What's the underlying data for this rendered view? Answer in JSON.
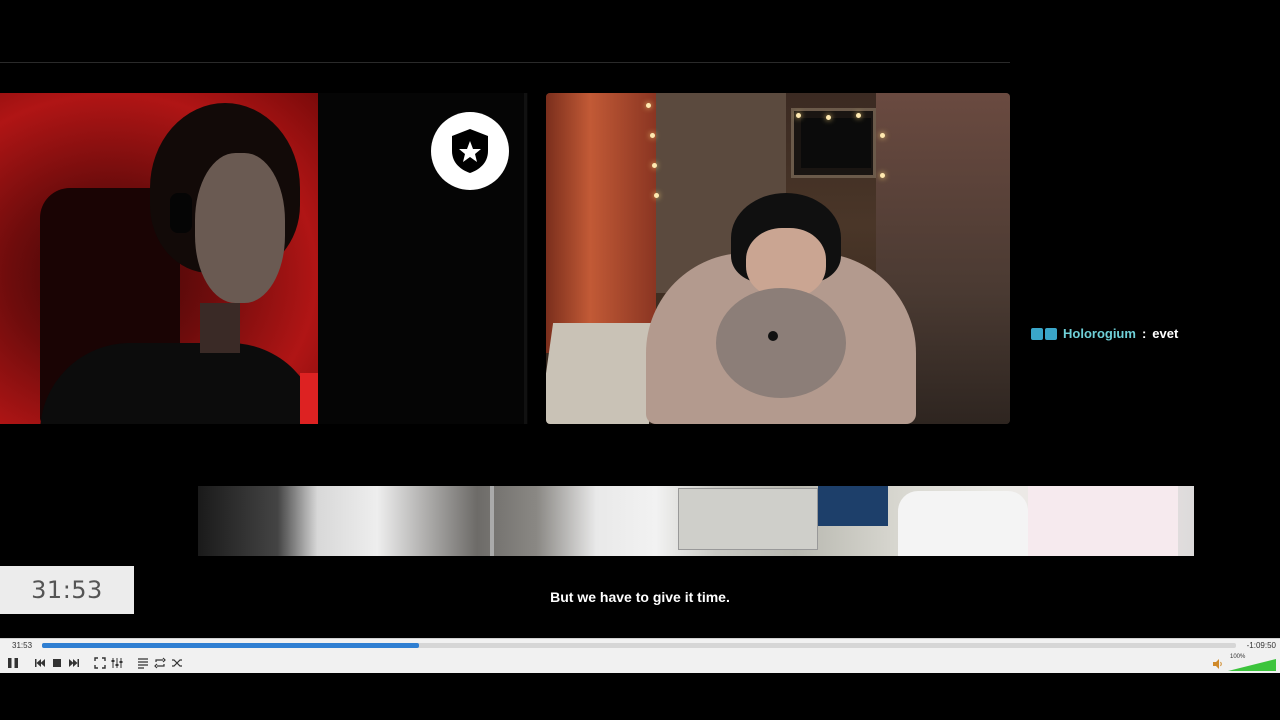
{
  "video": {
    "chat": {
      "username": "Holorogium",
      "separator": ":",
      "message": "evet"
    },
    "overlay_timestamp": "31:53",
    "subtitle": "But we have to give it time."
  },
  "player": {
    "elapsed": "31:53",
    "remaining": "-1:09:50",
    "progress": 0.316,
    "volume_label": "100%",
    "volume": 1.0,
    "accent_color": "#2f7fd2",
    "volume_color": "#3cc43c",
    "buttons": [
      "pause-icon",
      "previous-icon",
      "stop-icon",
      "next-icon",
      "fullscreen-icon",
      "extended-settings-icon",
      "playlist-icon",
      "loop-icon",
      "shuffle-icon",
      "speaker-icon"
    ]
  }
}
